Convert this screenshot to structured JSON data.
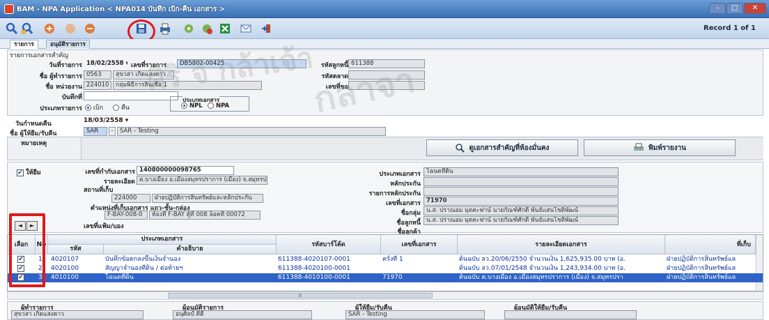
{
  "window": {
    "title": "BAM - NPA Application < NPA014 บันทึก เบิก-คืน เอกสาร >",
    "record_indicator": "Record 1 of 1",
    "minimize": "–",
    "maximize": "□",
    "close": "✕"
  },
  "toolbar": {
    "icons": [
      "search-icon",
      "find-icon",
      "add-icon",
      "circle-icon",
      "back-icon",
      "save-icon",
      "print-icon",
      "settings-icon",
      "refresh-icon",
      "excel-icon",
      "mail-icon",
      "exit-icon"
    ]
  },
  "tabs": [
    {
      "label": "รายการ"
    },
    {
      "label": "อนุมัติรายการ"
    }
  ],
  "section_title": "รายการเอกสารสำคัญ",
  "form": {
    "date_label": "วันที่รายการ",
    "date_value": "18/02/2558",
    "doc_no_label": "เลขที่รายการ",
    "doc_no_value": "DB5802-00425",
    "customer_code_label": "รหัสลูกหนี้",
    "customer_code_value": "611388",
    "requester_label": "ชื่อ ผู้ทำรายการ",
    "requester_code": "0563",
    "requester_name": "สุขวสา เกิดแสงดาว",
    "unit_label": "ชื่อ หน่วยงาน",
    "unit_code": "224010",
    "unit_name": "กลุ่มพิธีการสินเชื่อ 1",
    "market_label": "รหัสตลาด",
    "request_no_label": "เลขที่ขอ",
    "note_label": "บันทึกที่",
    "type_label": "ประเภทรายการ",
    "type_options": [
      "เบิก",
      "คืน"
    ],
    "type_selected": "เบิก",
    "doc_type_label": "ประเภทเอกสาร",
    "doc_type_options": [
      "NPL",
      "NPA"
    ],
    "doc_type_selected": "NPL",
    "return_date_label": "วันกำหนดคืน",
    "return_date_value": "18/03/2558",
    "borrower_label": "ชื่อ ผู้ให้ยืม/รับคืน",
    "borrower_code": "SAR",
    "borrower_name": "SAR - Testing",
    "remark_label": "หมายเหตุ"
  },
  "buttons": {
    "view_docs": "ดูเอกสารสำคัญที่ห้องมั่นคง",
    "print_report": "พิมพ์รายงาน"
  },
  "detail": {
    "lend_label": "ให้ยืม",
    "storage_no_label": "เลขที่กำกับเอกสาร",
    "storage_no_value": "140800000098765",
    "description_label": "รายละเอียด",
    "description_value": "ต.บางเมือง อ.เมืองสมุทรปราการ (เมือง) จ.สมุทรปราการ",
    "location_label": "สถานที่เก็บ",
    "location_code": "224000",
    "location_name": "ฝ่ายปฏิบัติการสินทรัพย์และหลักประกัน",
    "position_label": "ตำแหน่งที่เก็บเอกสาร แถว-ชั้น-กล่อง",
    "position_code": "F-BAY-008-0",
    "position_name": "ห้องที่ F-BAY ตู้ที่ 008 ล็อคที่ 00072",
    "folder_label": "เลขที่แฟ้ม/บอง",
    "doc_type_label": "ประเภทเอกสาร",
    "doc_type_value": "โฉนดที่ดิน",
    "collateral_label": "หลักประกัน",
    "collateral_item_label": "รายการหลักประกัน",
    "doc_number_label": "เลขที่เอกสาร",
    "doc_number_value": "71970",
    "group_label": "ชื่อกลุ่ม",
    "group_value": "น.ส. ปราณอม มุตตะฟาน์ นายกัณฑ์ศักดิ์ พันธ์แสนโชติพัฒน์",
    "debtor_label": "ชื่อลูกหนี้",
    "debtor_value": "น.ส. ปราณอม มุตตะฟาน์ นายกัณฑ์ศักดิ์ พันธ์แสนโชติพัฒน์",
    "owner_label": "ชื่อลูกค้า"
  },
  "nav": {
    "prev": "◄",
    "next": "►"
  },
  "grid": {
    "headers": {
      "select": "เลือก",
      "no": "No",
      "doc_type_group": "ประเภทเอกสาร",
      "code": "รหัส",
      "desc": "คำอธิบาย",
      "barcode": "รหัสบาร์โค้ด",
      "docno": "เลขที่เอกสาร",
      "detail": "รายละเอียดเอกสาร",
      "store": "ที่เก็บ"
    },
    "rows": [
      {
        "no": "1",
        "code": "4020107",
        "desc": "บันทึกข้อตกลงขึ้นเงินจำนอง",
        "barcode": "611388-4020107-0001",
        "docno": "ครั้งที่ 1",
        "detail": "ต้นฉบับ ลว.20/06/2550 จำนวนเงิน 1,625,935.00 บาท (อ.",
        "store": "ฝ่ายปฏิบัติการสินทรัพย์แล",
        "checked": "✔",
        "selected": false
      },
      {
        "no": "2",
        "code": "4020100",
        "desc": "สัญญาจำนองที่ดิน / ต่อท้ายฯ",
        "barcode": "611388-4020100-0001",
        "docno": "",
        "detail": "ต้นฉบับ ลว.07/01/2548 จำนวนเงิน 1,243,934.00 บาท (อ.",
        "store": "ฝ่ายปฏิบัติการสินทรัพย์แล",
        "checked": "✔",
        "selected": false
      },
      {
        "no": "3",
        "code": "4010100",
        "desc": "โฉนดที่ดิน",
        "barcode": "611388-4010100-0001",
        "docno": "71970",
        "detail": "ต้นฉบับ ต.บางเมือง อ.เมืองสมุทรปราการ (เมือง) จ.สมุทรปรา",
        "store": "ฝ่ายปฏิบัติการสินทรัพย์แล",
        "checked": "✔",
        "selected": true
      }
    ],
    "row_cursor": "I"
  },
  "scroll": {
    "thumb": "III"
  },
  "footer": {
    "maker_label": "ผู้ทำรายการ",
    "maker_value": "สุขวสา เกิดแสงดาว",
    "approver_label": "ผู้อนุมัติรายการ",
    "approver_value": "อนุศิลป์ ดีดี",
    "lender_label": "ผู้ให้ยืม/รับคืน",
    "lender_value": "SAR - Testing",
    "lend_approver_label": "ผู้อนุมัติให้ยืม/รับคืน"
  },
  "watermark": {
    "text1": "ศิริ จิ กล้าเจ้า",
    "text2": "กลาจา"
  },
  "colors": {
    "titlebar": "#3a6fb4",
    "selected_row": "#2f62c7",
    "highlight": "#e0191c"
  }
}
